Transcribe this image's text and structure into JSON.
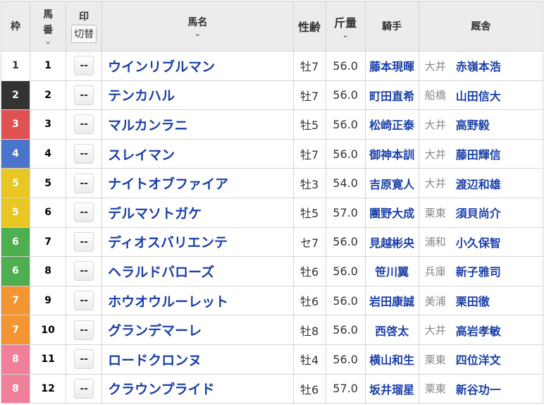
{
  "header": {
    "waku": "枠",
    "umaban_line1": "馬",
    "umaban_line2": "番",
    "mark": "印",
    "mark_toggle": "切替",
    "horse_name": "馬名",
    "sex_age": "性齢",
    "weight": "斤量",
    "jockey": "騎手",
    "stable": "厩舎",
    "sort_icon": "chevron-down-icon"
  },
  "waku_colors": {
    "1": "#ffffff",
    "2": "#333333",
    "3": "#e05252",
    "4": "#4a74c9",
    "5": "#e8c623",
    "6": "#4fae4f",
    "7": "#f29532",
    "8": "#ef7f9b"
  },
  "link_color": "#1a3fa8",
  "rows": [
    {
      "waku": "1",
      "umaban": "1",
      "mark": "--",
      "name": "ウインリブルマン",
      "sex_age": "牡7",
      "weight": "56.0",
      "jockey": "藤本現暉",
      "region": "大井",
      "trainer": "赤嶺本浩"
    },
    {
      "waku": "2",
      "umaban": "2",
      "mark": "--",
      "name": "テンカハル",
      "sex_age": "牡7",
      "weight": "56.0",
      "jockey": "町田直希",
      "region": "船橋",
      "trainer": "山田信大"
    },
    {
      "waku": "3",
      "umaban": "3",
      "mark": "--",
      "name": "マルカンラニ",
      "sex_age": "牡5",
      "weight": "56.0",
      "jockey": "松崎正泰",
      "region": "大井",
      "trainer": "高野毅"
    },
    {
      "waku": "4",
      "umaban": "4",
      "mark": "--",
      "name": "スレイマン",
      "sex_age": "牡7",
      "weight": "56.0",
      "jockey": "御神本訓",
      "region": "大井",
      "trainer": "藤田輝信"
    },
    {
      "waku": "5",
      "umaban": "5",
      "mark": "--",
      "name": "ナイトオブファイア",
      "sex_age": "牡3",
      "weight": "54.0",
      "jockey": "吉原寛人",
      "region": "大井",
      "trainer": "渡辺和雄"
    },
    {
      "waku": "5",
      "umaban": "6",
      "mark": "--",
      "name": "デルマソトガケ",
      "sex_age": "牡5",
      "weight": "57.0",
      "jockey": "團野大成",
      "region": "栗東",
      "trainer": "須貝尚介"
    },
    {
      "waku": "6",
      "umaban": "7",
      "mark": "--",
      "name": "ディオスバリエンテ",
      "sex_age": "セ7",
      "weight": "56.0",
      "jockey": "見越彬央",
      "region": "浦和",
      "trainer": "小久保智"
    },
    {
      "waku": "6",
      "umaban": "8",
      "mark": "--",
      "name": "ヘラルドバローズ",
      "sex_age": "牡6",
      "weight": "56.0",
      "jockey": "笹川翼",
      "region": "兵庫",
      "trainer": "新子雅司"
    },
    {
      "waku": "7",
      "umaban": "9",
      "mark": "--",
      "name": "ホウオウルーレット",
      "sex_age": "牡6",
      "weight": "56.0",
      "jockey": "岩田康誠",
      "region": "美浦",
      "trainer": "栗田徹"
    },
    {
      "waku": "7",
      "umaban": "10",
      "mark": "--",
      "name": "グランデマーレ",
      "sex_age": "牡8",
      "weight": "56.0",
      "jockey": "西啓太",
      "region": "大井",
      "trainer": "高岩孝敏"
    },
    {
      "waku": "8",
      "umaban": "11",
      "mark": "--",
      "name": "ロードクロンヌ",
      "sex_age": "牡4",
      "weight": "56.0",
      "jockey": "横山和生",
      "region": "栗東",
      "trainer": "四位洋文"
    },
    {
      "waku": "8",
      "umaban": "12",
      "mark": "--",
      "name": "クラウンプライド",
      "sex_age": "牡6",
      "weight": "57.0",
      "jockey": "坂井瑠星",
      "region": "栗東",
      "trainer": "新谷功一"
    }
  ]
}
